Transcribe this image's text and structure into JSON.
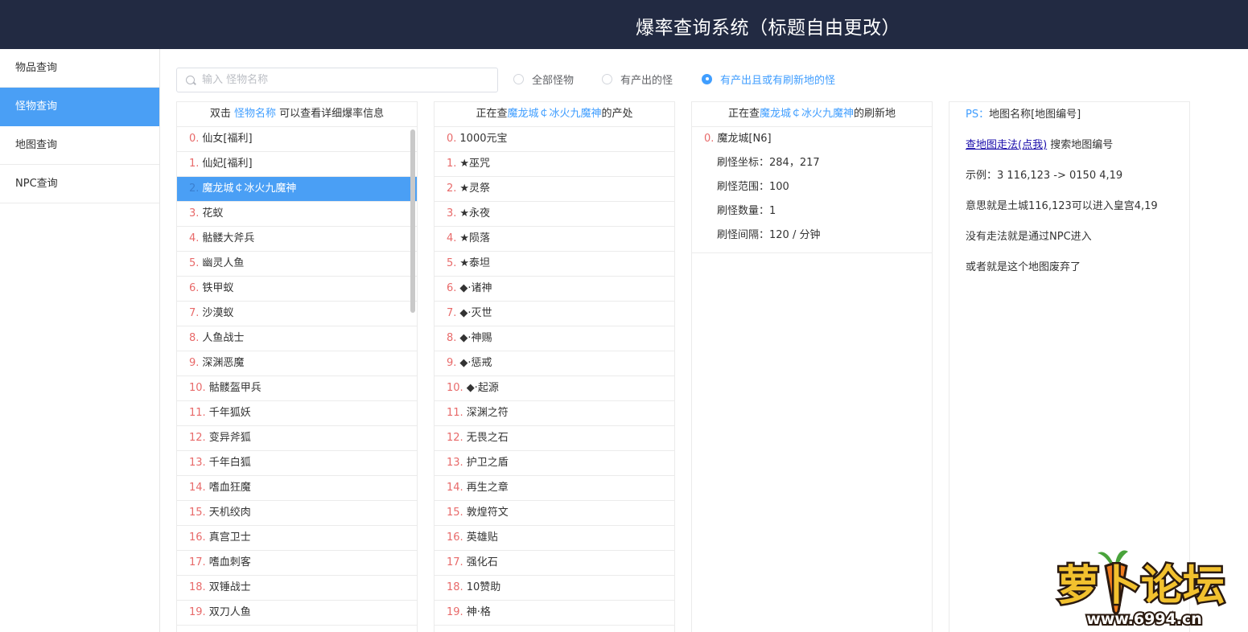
{
  "header": {
    "title": "爆率查询系统（标题自由更改）"
  },
  "sidebar": {
    "items": [
      {
        "label": "物品查询",
        "active": false
      },
      {
        "label": "怪物查询",
        "active": true
      },
      {
        "label": "地图查询",
        "active": false
      },
      {
        "label": "NPC查询",
        "active": false
      }
    ]
  },
  "search": {
    "placeholder": "输入 怪物名称",
    "value": ""
  },
  "filters": [
    {
      "label": "全部怪物",
      "checked": false
    },
    {
      "label": "有产出的怪",
      "checked": false
    },
    {
      "label": "有产出且或有刷新地的怪",
      "checked": true
    }
  ],
  "monster_panel": {
    "head_prefix": "双击 ",
    "head_highlight": "怪物名称",
    "head_suffix": " 可以查看详细爆率信息",
    "selected_index": 2,
    "items": [
      {
        "idx": "0.",
        "name": "仙女[福利]"
      },
      {
        "idx": "1.",
        "name": "仙妃[福利]"
      },
      {
        "idx": "2.",
        "name": "魔龙城￠冰火九魔神"
      },
      {
        "idx": "3.",
        "name": "花蚁"
      },
      {
        "idx": "4.",
        "name": "骷髅大斧兵"
      },
      {
        "idx": "5.",
        "name": "幽灵人鱼"
      },
      {
        "idx": "6.",
        "name": "铁甲蚁"
      },
      {
        "idx": "7.",
        "name": "沙漠蚁"
      },
      {
        "idx": "8.",
        "name": "人鱼战士"
      },
      {
        "idx": "9.",
        "name": "深渊恶魔"
      },
      {
        "idx": "10.",
        "name": "骷髅盔甲兵"
      },
      {
        "idx": "11.",
        "name": "千年狐妖"
      },
      {
        "idx": "12.",
        "name": "变异斧狐"
      },
      {
        "idx": "13.",
        "name": "千年白狐"
      },
      {
        "idx": "14.",
        "name": "嗜血狂魔"
      },
      {
        "idx": "15.",
        "name": "天机绞肉"
      },
      {
        "idx": "16.",
        "name": "真宫卫士"
      },
      {
        "idx": "17.",
        "name": "嗜血刺客"
      },
      {
        "idx": "18.",
        "name": "双锤战士"
      },
      {
        "idx": "19.",
        "name": "双刀人鱼"
      }
    ]
  },
  "drops_panel": {
    "head_prefix": "正在查",
    "head_highlight": "魔龙城￠冰火九魔神",
    "head_suffix": "的产处",
    "items": [
      {
        "idx": "0.",
        "name": "1000元宝"
      },
      {
        "idx": "1.",
        "name": "★巫咒"
      },
      {
        "idx": "2.",
        "name": "★灵祭"
      },
      {
        "idx": "3.",
        "name": "★永夜"
      },
      {
        "idx": "4.",
        "name": "★陨落"
      },
      {
        "idx": "5.",
        "name": "★泰坦"
      },
      {
        "idx": "6.",
        "name": "◆·诸神"
      },
      {
        "idx": "7.",
        "name": "◆·灭世"
      },
      {
        "idx": "8.",
        "name": "◆·神赐"
      },
      {
        "idx": "9.",
        "name": "◆·惩戒"
      },
      {
        "idx": "10.",
        "name": "◆·起源"
      },
      {
        "idx": "11.",
        "name": "深渊之符"
      },
      {
        "idx": "12.",
        "name": "无畏之石"
      },
      {
        "idx": "13.",
        "name": "护卫之盾"
      },
      {
        "idx": "14.",
        "name": "再生之章"
      },
      {
        "idx": "15.",
        "name": "敦煌符文"
      },
      {
        "idx": "16.",
        "name": "英雄贴"
      },
      {
        "idx": "17.",
        "name": "强化石"
      },
      {
        "idx": "18.",
        "name": "10赞助"
      },
      {
        "idx": "19.",
        "name": "神·格"
      }
    ]
  },
  "spawn_panel": {
    "head_prefix": "正在查",
    "head_highlight": "魔龙城￠冰火九魔神",
    "head_suffix": "的刷新地",
    "idx": "0.",
    "map_name": "魔龙城[N6]",
    "details": [
      "刷怪坐标：284，217",
      "刷怪范围：100",
      "刷怪数量：1",
      "刷怪间隔：120 / 分钟"
    ]
  },
  "ps_panel": {
    "ps_label": "PS：",
    "ps_text": "地图名称[地图编号]",
    "link_text": "查地图走法(点我)",
    "link_suffix": " 搜索地图编号",
    "example": "示例：3 116,123 -> 0150 4,19",
    "meaning": "意思就是土城116,123可以进入皇宫4,19",
    "no_path": "没有走法就是通过NPC进入",
    "abandoned": "或者就是这个地图废弃了"
  },
  "watermark": {
    "logo_text": "萝卜论坛",
    "url": "www.6994.cn"
  },
  "colors": {
    "header_bg": "#222a42",
    "accent": "#409eff",
    "active_bg": "#4a9ff5",
    "index_red": "#e86a6a"
  }
}
